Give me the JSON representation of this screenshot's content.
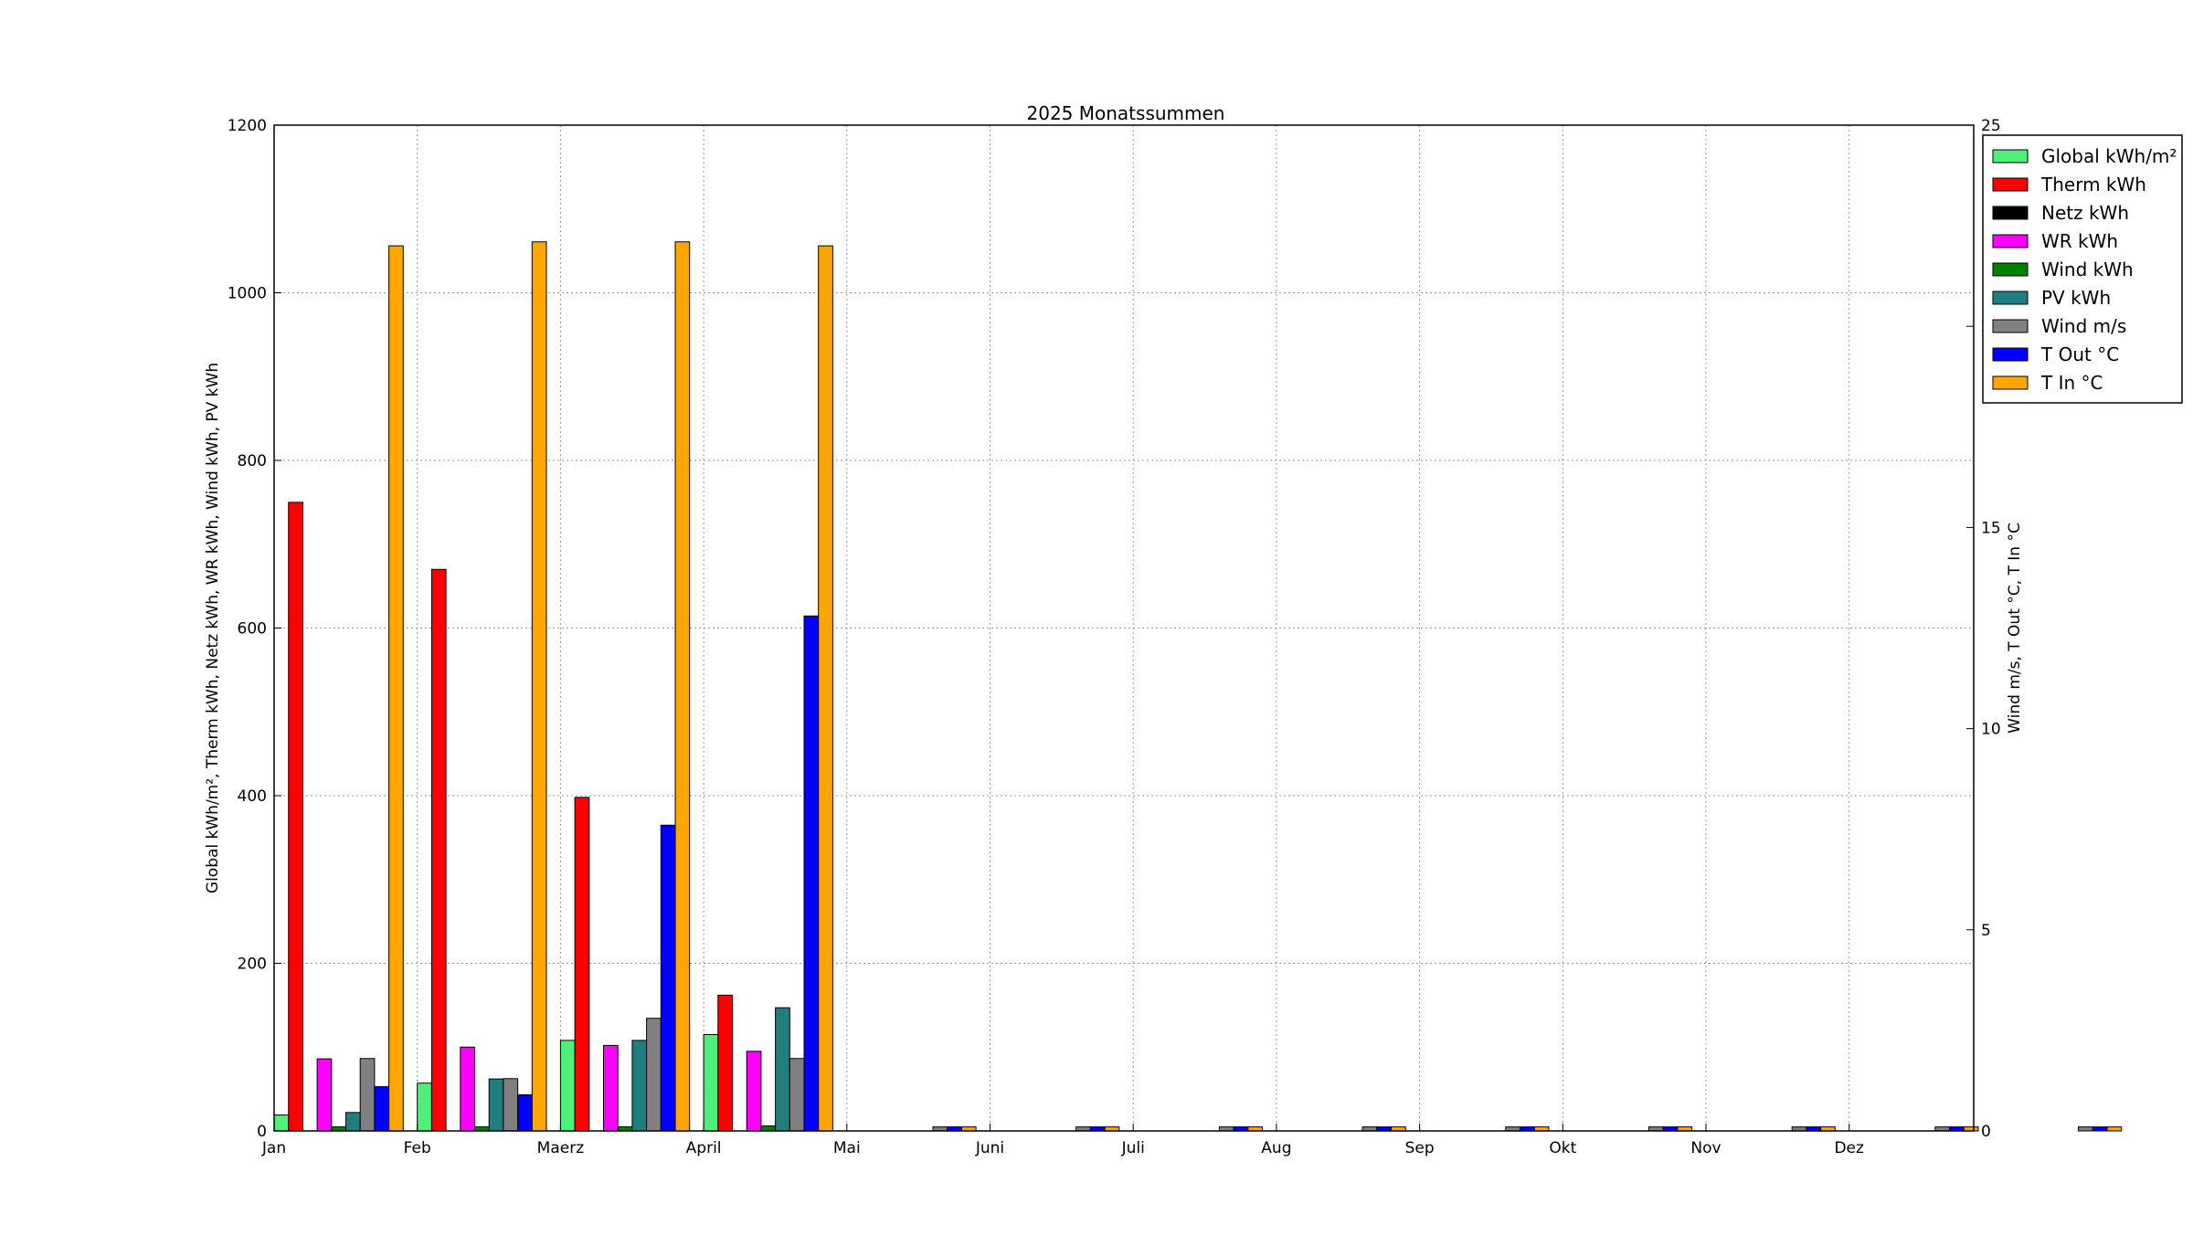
{
  "chart_data": {
    "type": "bar",
    "title": "2025 Monatssummen",
    "ylabel_left": "Global kWh/m², Therm kWh, Netz kWh, WR kWh, Wind kWh, PV kWh",
    "ylabel_right": "Wind m/s, T Out °C, T In °C",
    "categories": [
      "Jan",
      "Feb",
      "Maerz",
      "April",
      "Mai",
      "Juni",
      "Juli",
      "Aug",
      "Sep",
      "Okt",
      "Nov",
      "Dez"
    ],
    "ylim_left": [
      0,
      1200
    ],
    "yticks_left": [
      0,
      200,
      400,
      600,
      800,
      1000,
      1200
    ],
    "ylim_right": [
      0,
      25
    ],
    "yticks_right": [
      0,
      5,
      10,
      15,
      20,
      25
    ],
    "grid": true,
    "legend_position": "upper-right, outside plot",
    "series": [
      {
        "name": "Global kWh/m²",
        "axis": "left",
        "color": "#4ef07a",
        "values": [
          19,
          57,
          108,
          115,
          0,
          0,
          0,
          0,
          0,
          0,
          0,
          0,
          0
        ]
      },
      {
        "name": "Therm kWh",
        "axis": "left",
        "color": "#ff0000",
        "values": [
          750,
          670,
          398,
          162,
          0,
          0,
          0,
          0,
          0,
          0,
          0,
          0,
          0
        ]
      },
      {
        "name": "Netz kWh",
        "axis": "left",
        "color": "#000000",
        "values": [
          0,
          0,
          0,
          0,
          0,
          0,
          0,
          0,
          0,
          0,
          0,
          0,
          0
        ]
      },
      {
        "name": "WR kWh",
        "axis": "left",
        "color": "#ff00ff",
        "values": [
          86,
          100,
          102,
          95,
          0,
          0,
          0,
          0,
          0,
          0,
          0,
          0,
          0
        ]
      },
      {
        "name": "Wind kWh",
        "axis": "left",
        "color": "#008000",
        "values": [
          5,
          5,
          5,
          6,
          0,
          0,
          0,
          0,
          0,
          0,
          0,
          0,
          0
        ]
      },
      {
        "name": "PV kWh",
        "axis": "left",
        "color": "#1f7f7f",
        "values": [
          22,
          62,
          108,
          147,
          0,
          0,
          0,
          0,
          0,
          0,
          0,
          0,
          0
        ]
      },
      {
        "name": "Wind m/s",
        "axis": "right",
        "color": "#808080",
        "values": [
          1.8,
          1.3,
          2.8,
          1.8,
          0.1,
          0.1,
          0.1,
          0.1,
          0.1,
          0.1,
          0.1,
          0.1,
          0.1
        ]
      },
      {
        "name": "T Out °C",
        "axis": "right",
        "color": "#0000ff",
        "values": [
          1.1,
          0.9,
          7.6,
          12.8,
          0.1,
          0.1,
          0.1,
          0.1,
          0.1,
          0.1,
          0.1,
          0.1,
          0.1
        ]
      },
      {
        "name": "T In °C",
        "axis": "right",
        "color": "#ffa500",
        "values": [
          22.0,
          22.1,
          22.1,
          22.0,
          0.1,
          0.1,
          0.1,
          0.1,
          0.1,
          0.1,
          0.1,
          0.1,
          0.1
        ]
      }
    ]
  }
}
